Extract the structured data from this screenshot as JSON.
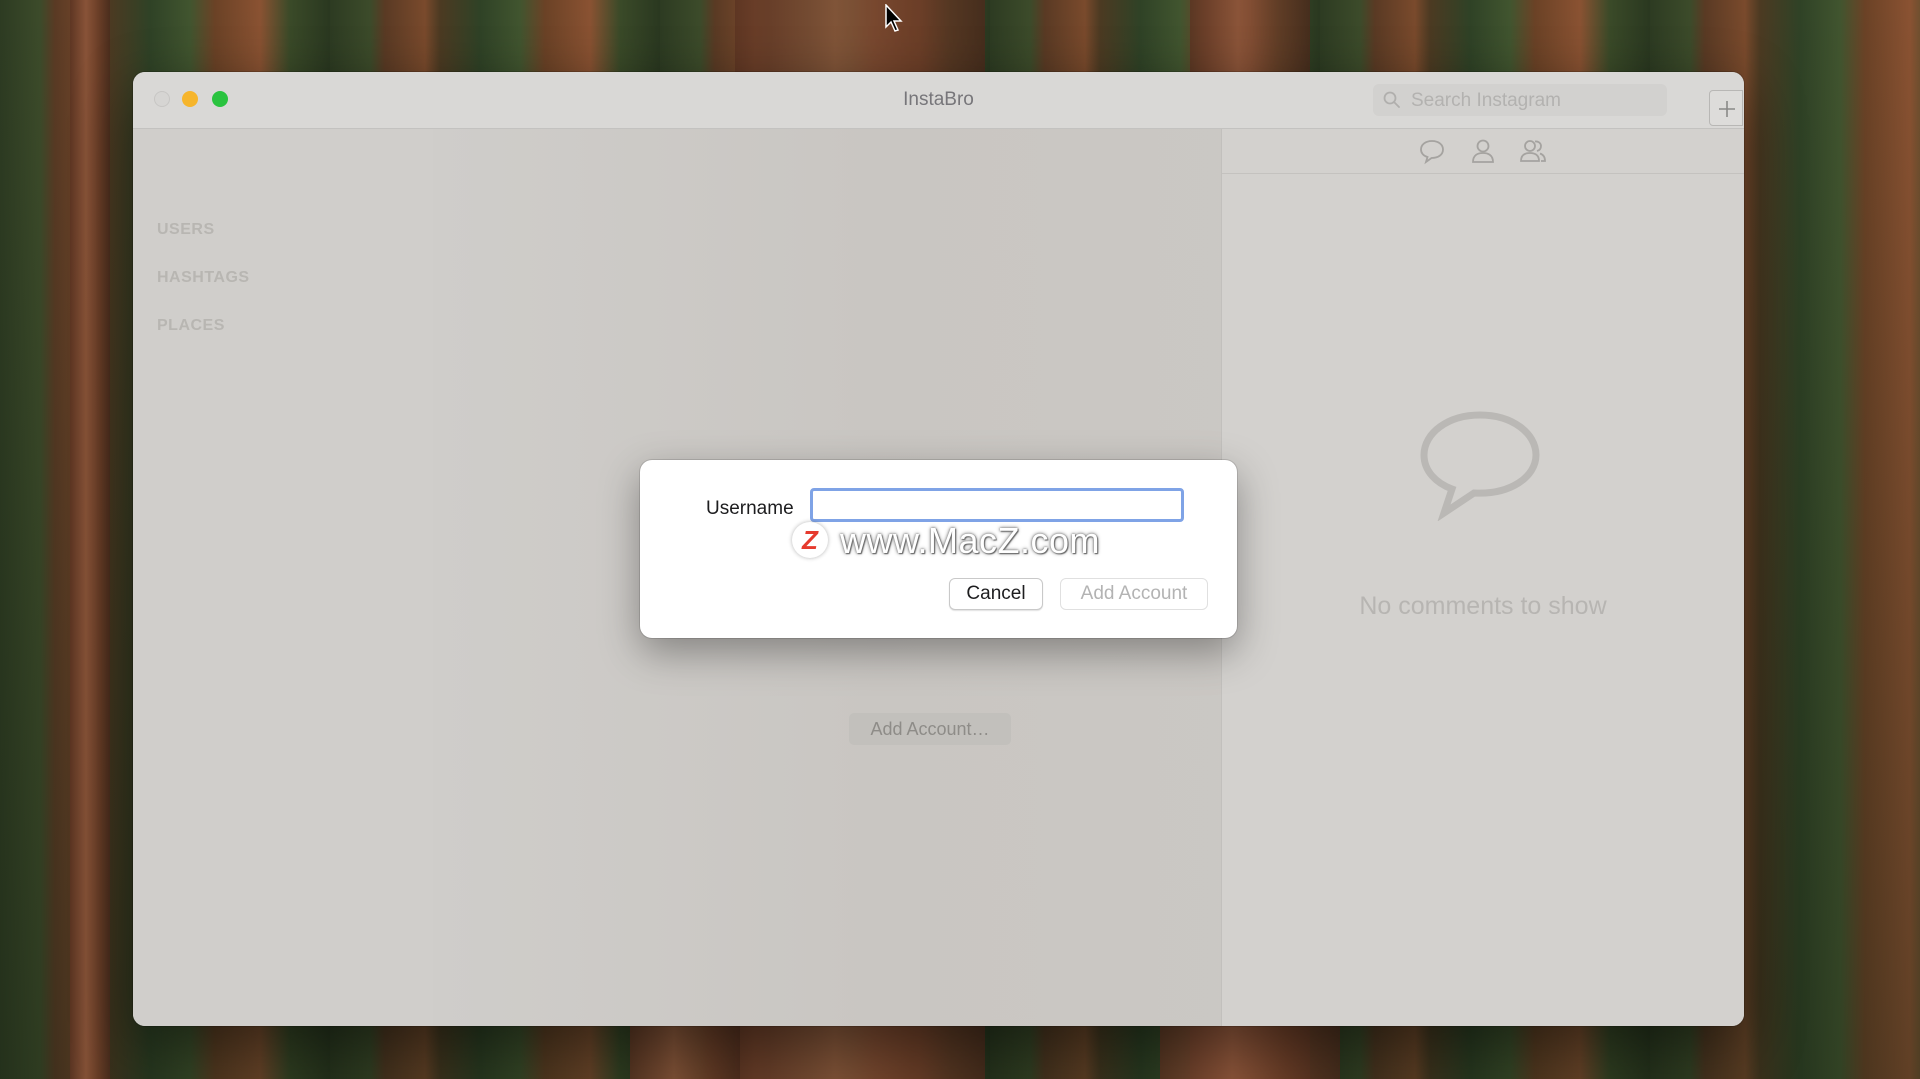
{
  "window": {
    "title": "InstaBro"
  },
  "search": {
    "placeholder": "Search Instagram"
  },
  "sidebar": {
    "items": [
      {
        "label": "USERS"
      },
      {
        "label": "HASHTAGS"
      },
      {
        "label": "PLACES"
      }
    ]
  },
  "main": {
    "add_account_label": "Add Account…"
  },
  "right_pane": {
    "toolbar_icons": [
      "comment-icon",
      "user-icon",
      "users-icon"
    ],
    "empty_message": "No comments to show"
  },
  "dialog": {
    "username_label": "Username",
    "username_value": "",
    "cancel_label": "Cancel",
    "add_account_label": "Add Account"
  },
  "watermark": {
    "badge": "Z",
    "text": "www.MacZ.com"
  },
  "colors": {
    "traffic_minimize": "#f6b52c",
    "traffic_maximize": "#2ac33f",
    "focus_ring": "#7fa3e6"
  }
}
